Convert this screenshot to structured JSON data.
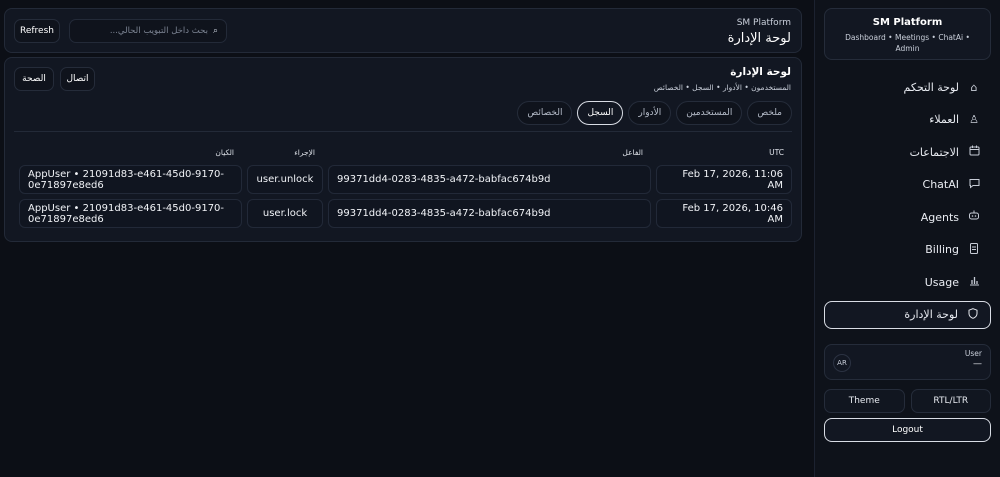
{
  "sidebar": {
    "brand_title": "SM Platform",
    "brand_subtitle": "Dashboard • Meetings • ChatAi • Admin",
    "items": [
      {
        "label": "لوحة التحكم",
        "icon": "home-icon"
      },
      {
        "label": "العملاء",
        "icon": "user-icon"
      },
      {
        "label": "الاجتماعات",
        "icon": "calendar-icon"
      },
      {
        "label": "ChatAI",
        "icon": "chat-icon"
      },
      {
        "label": "Agents",
        "icon": "robot-icon"
      },
      {
        "label": "Billing",
        "icon": "document-icon"
      },
      {
        "label": "Usage",
        "icon": "bar-chart-icon"
      },
      {
        "label": "لوحة الإدارة",
        "icon": "shield-icon",
        "active": true
      }
    ],
    "user_label": "User",
    "user_value": "—",
    "lang_badge": "AR",
    "rtl_button": "RTL/LTR",
    "theme_button": "Theme",
    "logout_button": "Logout"
  },
  "topbar": {
    "platform_name": "SM Platform",
    "page_heading": "لوحة الإدارة",
    "refresh_label": "Refresh",
    "search_placeholder": "بحث داخل التبويب الحالي..."
  },
  "panel": {
    "title": "لوحة الإدارة",
    "breadcrumb": "المستخدمون • الأدوار • السجل • الخصائص",
    "connection_button": "اتصال",
    "health_button": "الصحة",
    "tabs": [
      {
        "label": "ملخص"
      },
      {
        "label": "المستخدمين"
      },
      {
        "label": "الأدوار"
      },
      {
        "label": "السجل",
        "active": true
      },
      {
        "label": "الخصائص"
      }
    ],
    "columns": {
      "utc": "UTC",
      "actor": "الفاعل",
      "action": "الإجراء",
      "entity": "الكيان"
    },
    "rows": [
      {
        "utc": "Feb 17, 2026, 11:06 AM",
        "actor": "99371dd4-0283-4835-a472-babfac674b9d",
        "action": "user.unlock",
        "entity": "AppUser • 21091d83-e461-45d0-9170-0e71897e8ed6"
      },
      {
        "utc": "Feb 17, 2026, 10:46 AM",
        "actor": "99371dd4-0283-4835-a472-babfac674b9d",
        "action": "user.lock",
        "entity": "AppUser • 21091d83-e461-45d0-9170-0e71897e8ed6"
      }
    ]
  }
}
